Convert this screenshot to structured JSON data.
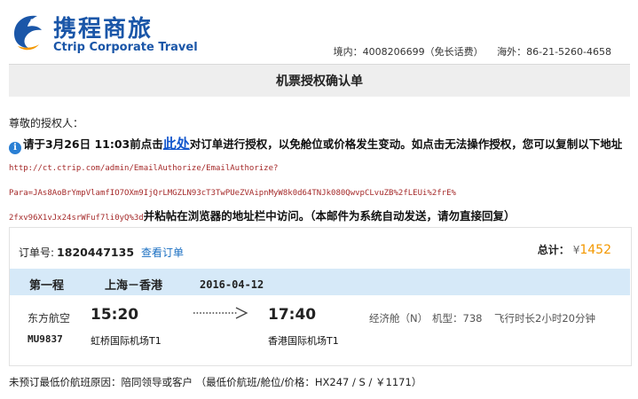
{
  "header": {
    "brand_cn": "携程商旅",
    "brand_en": "Ctrip Corporate Travel",
    "hotline_domestic": "境内：4008206699（免长话费）",
    "hotline_overseas": "海外：86-21-5260-4658"
  },
  "page_title": "机票授权确认单",
  "greeting": "尊敬的授权人：",
  "message": {
    "info_icon": "i",
    "before_link": "请于3月26日 11:03前点击",
    "link_text": "此处",
    "after_link": "对订单进行授权，以免舱位或价格发生变动。如点击无法操作授权，您可以复制以下地址",
    "url_line1": "http://ct.ctrip.com/admin/EmailAuthorize/EmailAuthorize?",
    "url_line2": "Para=JAs8AoBrYmpVlamfIO7OXm9IjQrLMGZLN93cT3TwPUeZVAipnMyW8k0d64TNJk080QwvpCLvuZB%2fLEUi%2frE%",
    "url_line3": "2fxv96X1vJx24srWFuf7li0yQ%3d",
    "after_url": "并粘帖在浏览器的地址栏中访问。（本邮件为系统自动发送，请勿直接回复）"
  },
  "order": {
    "number_label": "订单号:",
    "number": "1820447135",
    "view_link": "查看订单",
    "total_label": "总计：",
    "currency": "¥",
    "total_amount": "1452"
  },
  "leg": {
    "label": "第一程",
    "route": "上海－香港",
    "date": "2016-04-12",
    "airline": "东方航空",
    "flight_no": "MU9837",
    "dep_time": "15:20",
    "dep_airport": "虹桥国际机场T1",
    "arr_time": "17:40",
    "arr_airport": "香港国际机场T1",
    "cabin": "经济舱（N）",
    "plane": "机型：738",
    "duration": "飞行时长2小时20分钟"
  },
  "reason": "未预订最低价航班原因：陪同领导或客户 （最低价航班/舱位/价格：HX247 / S / ￥1171）",
  "colors": {
    "brand": "#1a56a8",
    "link": "#1a6fc2",
    "price": "#f39800",
    "leg_bar": "#d6e9f8",
    "url": "#a52a2a"
  }
}
